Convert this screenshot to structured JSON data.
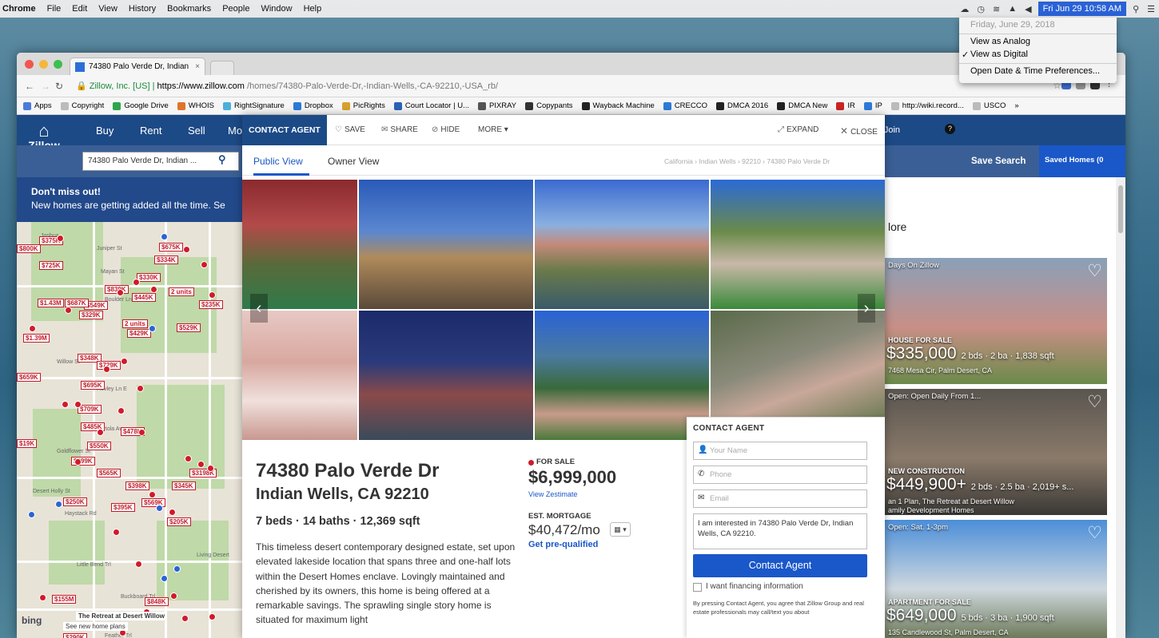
{
  "macbar": {
    "app": "Chrome",
    "menus": [
      "File",
      "Edit",
      "View",
      "History",
      "Bookmarks",
      "People",
      "Window",
      "Help"
    ],
    "clock": "Fri Jun 29  10:58 AM"
  },
  "clock_menu": {
    "date": "Friday, June 29, 2018",
    "view_analog": "View as Analog",
    "view_digital": "View as Digital",
    "checkmark": "✓",
    "preferences": "Open Date & Time Preferences..."
  },
  "browser": {
    "tab_title": "74380 Palo Verde Dr, Indian",
    "tab_close": "×",
    "address_lock": "🔒",
    "address_company": " Zillow, Inc. [US] | ",
    "address_domain": "https://www.zillow.com",
    "address_path": "/homes/74380-Palo-Verde-Dr,-Indian-Wells,-CA-92210,-USA_rb/",
    "bookmarks": [
      {
        "label": "Apps",
        "color": "#4a7ad9"
      },
      {
        "label": "Copyright",
        "color": "#bbbbbb"
      },
      {
        "label": "Google Drive",
        "color": "#2fa64b"
      },
      {
        "label": "WHOIS",
        "color": "#e0742a"
      },
      {
        "label": "RightSignature",
        "color": "#4bb0d8"
      },
      {
        "label": "Dropbox",
        "color": "#2d7ad9"
      },
      {
        "label": "PicRights",
        "color": "#d8a12d"
      },
      {
        "label": "Court Locator | U...",
        "color": "#2b63b8"
      },
      {
        "label": "PIXRAY",
        "color": "#555555"
      },
      {
        "label": "Copypants",
        "color": "#333333"
      },
      {
        "label": "Wayback Machine",
        "color": "#222222"
      },
      {
        "label": "CRECCO",
        "color": "#2d7ad9"
      },
      {
        "label": "DMCA 2016",
        "color": "#222222"
      },
      {
        "label": "DMCA New",
        "color": "#222222"
      },
      {
        "label": "IR",
        "color": "#cc2222"
      },
      {
        "label": "IP",
        "color": "#2d7ad9"
      },
      {
        "label": "http://wiki.record...",
        "color": "#bbbbbb"
      },
      {
        "label": "USCO",
        "color": "#bbbbbb"
      }
    ],
    "bookmarks_overflow": "»"
  },
  "zillow": {
    "logo": "Zillow",
    "nav": {
      "buy": "Buy",
      "rent": "Rent",
      "sell": "Sell",
      "mortgage_partial": "Mo"
    },
    "join": "or Join",
    "help": "?",
    "search_value": "74380 Palo Verde Dr, Indian ...",
    "save_search": "Save Search",
    "saved_homes": "Saved Homes (0",
    "banner_title": "Don't miss out!",
    "banner_text": "New homes are getting added all the time. Se",
    "more_partial": "lore"
  },
  "map": {
    "price_labels": [
      "$375K",
      "$675K",
      "$334K",
      "$725K",
      "$330K",
      "$839K",
      "$445K",
      "2 units",
      "$235K",
      "$549K",
      "$329K",
      "2 units",
      "$529K",
      "$1.39M",
      "$429K",
      "$348K",
      "$729K",
      "$695K",
      "$709K",
      "$485K",
      "$478K",
      "$550K",
      "$599K",
      "$565K",
      "$398K",
      "$345K",
      "$250K",
      "$395K",
      "$569K",
      "$205K",
      "$155M",
      "$848K",
      "$290K",
      "$3198K",
      "$800K",
      "$1.43M",
      "$687K",
      "$659K",
      "$19K"
    ],
    "streets": [
      "Joshua",
      "Juniper St",
      "Mayan St",
      "Boulder Ln",
      "Willow St",
      "Hovley Ln E",
      "Portola Ave",
      "Goldflower St",
      "Desert Holly St",
      "Haystack Rd",
      "Little Bend Trl",
      "Buckboard Trl",
      "Feather Trl",
      "Living Desert"
    ],
    "cluster_label_1": "The Retreat at Desert Willow",
    "cluster_label_2": "See new home plans",
    "bing": "bing"
  },
  "modal": {
    "contact_agent_tab": "CONTACT AGENT",
    "save": "SAVE",
    "share": "SHARE",
    "hide": "HIDE",
    "more": "MORE ▾",
    "expand": "EXPAND",
    "close": "CLOSE",
    "public_view": "Public View",
    "owner_view": "Owner View",
    "breadcrumb": "California › Indian Wells › 92210 › 74380 Palo Verde Dr",
    "address_line1": "74380 Palo Verde Dr",
    "address_line2": "Indian Wells, CA 92210",
    "facts": "7 beds · 14 baths · 12,369 sqft",
    "description": "This timeless desert contemporary designed estate, set upon elevated lakeside location that spans three and one-half lots within the Desert Homes enclave. Lovingly maintained and cherished by its owners, this home is being offered at a remarkable savings. The sprawling single story home is situated for maximum light",
    "status": "FOR SALE",
    "price": "$6,999,000",
    "zestimate": "View Zestimate",
    "est_mortgage_label": "EST. MORTGAGE",
    "mortgage": "$40,472/mo",
    "mortgage_dropdown": "▾",
    "prequal": "Get pre-qualified"
  },
  "contact_form": {
    "heading": "CONTACT AGENT",
    "name_placeholder": "Your Name",
    "phone_placeholder": "Phone",
    "email_placeholder": "Email",
    "message": "I am interested in 74380 Palo Verde Dr, Indian Wells, CA 92210.",
    "submit": "Contact Agent",
    "financing": "I want financing information",
    "legal": "By pressing Contact Agent, you agree that Zillow Group and real estate professionals may call/text you about"
  },
  "listings": [
    {
      "badge": "Days On Zillow",
      "type": "HOUSE FOR SALE",
      "price": "$335,000",
      "details": "2 bds · 2 ba · 1,838 sqft",
      "address": "7468 Mesa Cir, Palm Desert, CA",
      "colors": [
        "#8aa0b8",
        "#c88f86",
        "#6b8a4a"
      ]
    },
    {
      "badge": "Open: Open Daily From 1...",
      "type": "NEW CONSTRUCTION",
      "price": "$449,900+",
      "details": "2 bds · 2.5 ba · 2,019+ s...",
      "address": "an 1 Plan, The Retreat at Desert Willow",
      "address2": "amily Development Homes",
      "colors": [
        "#5a5550",
        "#8a7a6a",
        "#3a3835"
      ]
    },
    {
      "badge": "Open: Sat. 1-3pm",
      "type": "APARTMENT FOR SALE",
      "price": "$649,000",
      "details": "5 bds · 3 ba · 1,900 sqft",
      "address": "135 Candlewood St, Palm Desert, CA",
      "colors": [
        "#4b8ed8",
        "#cfd8de",
        "#5d6b45"
      ]
    }
  ]
}
